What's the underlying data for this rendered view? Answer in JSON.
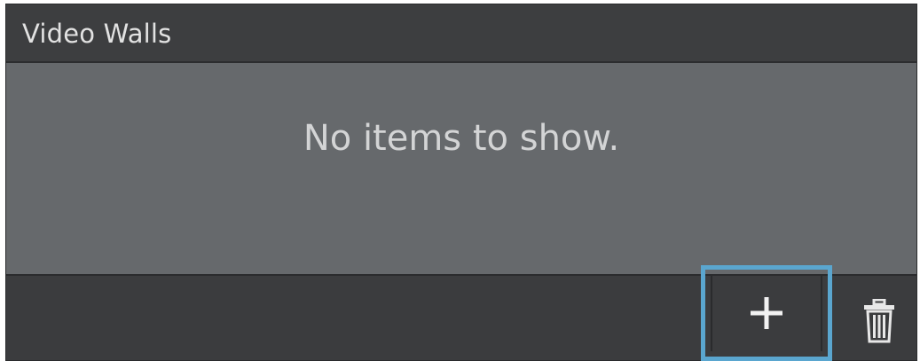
{
  "panel": {
    "title": "Video Walls",
    "empty_message": "No items to show."
  },
  "toolbar": {
    "add_icon": "plus-icon",
    "delete_icon": "trash-icon",
    "highlight_color": "#5aa6cf"
  },
  "colors": {
    "header_bg": "#3d3e40",
    "content_bg": "#66696c",
    "footer_bg": "#3b3c3e",
    "text": "#e2e2e2"
  }
}
